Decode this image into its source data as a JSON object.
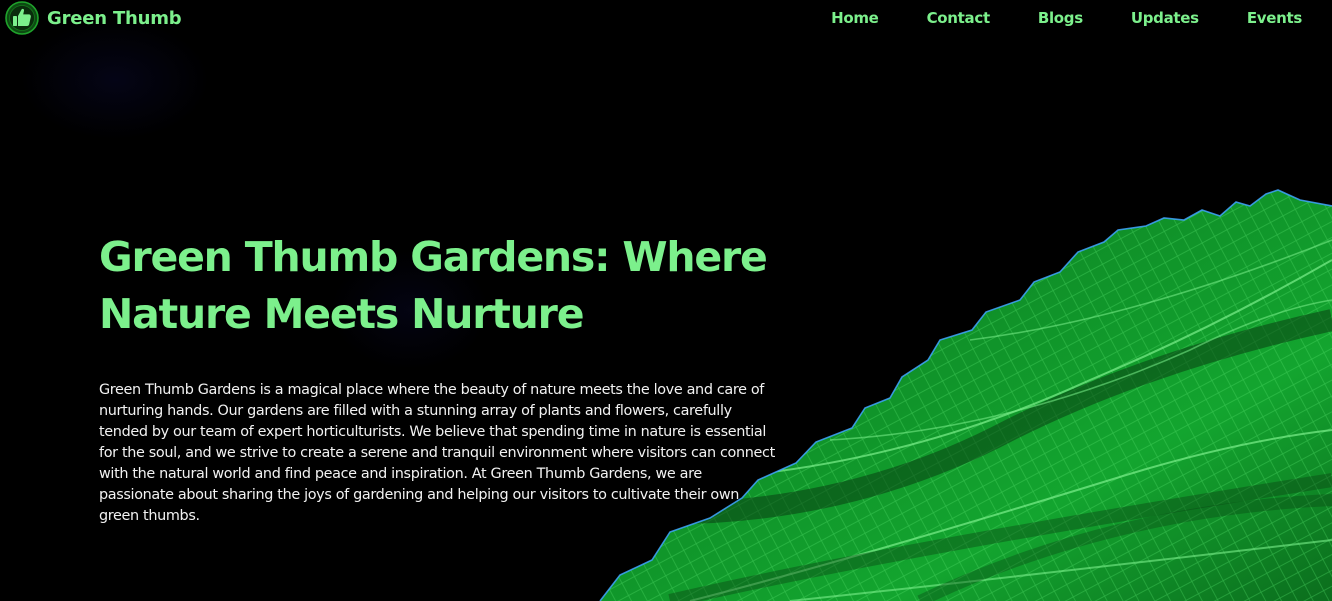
{
  "header": {
    "brand_name": "Green Thumb",
    "logo_icon": "thumbs-up-icon",
    "nav_items": [
      {
        "label": "Home"
      },
      {
        "label": "Contact"
      },
      {
        "label": "Blogs"
      },
      {
        "label": "Updates"
      },
      {
        "label": "Events"
      }
    ]
  },
  "hero": {
    "title": "Green Thumb Gardens: Where Nature Meets Nurture",
    "description": "Green Thumb Gardens is a magical place where the beauty of nature meets the love and care of nurturing hands. Our gardens are filled with a stunning array of plants and flowers, carefully tended by our team of expert horticulturists. We believe that spending time in nature is essential for the soul, and we strive to create a serene and tranquil environment where visitors can connect with the natural world and find peace and inspiration. At Green Thumb Gardens, we are passionate about sharing the joys of gardening and helping our visitors to cultivate their own green thumbs.",
    "image": "green-leaf-closeup"
  },
  "colors": {
    "background": "#000000",
    "accent": "#7CF08C",
    "body_text": "#F2F2F2",
    "leaf_green": "#0F9A2A",
    "vein_blue": "#3FA6FF"
  }
}
